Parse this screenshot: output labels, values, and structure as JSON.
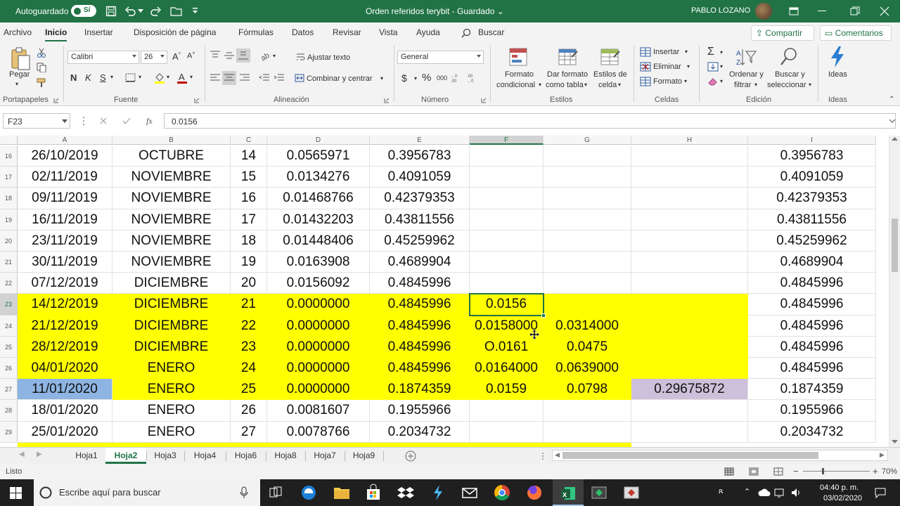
{
  "titlebar": {
    "autosave_label": "Autoguardado",
    "autosave_state": "Sí",
    "doc_title": "Orden referidos terybit  -  Guardado  ⌄",
    "user_name": "PABLO LOZANO"
  },
  "ribbon_tabs": [
    "Archivo",
    "Inicio",
    "Insertar",
    "Disposición de página",
    "Fórmulas",
    "Datos",
    "Revisar",
    "Vista",
    "Ayuda"
  ],
  "tell_me": "Buscar",
  "share_label": "Compartir",
  "comments_label": "Comentarios",
  "ribbon": {
    "clipboard": {
      "paste": "Pegar",
      "group": "Portapapeles"
    },
    "font": {
      "name": "Calibri",
      "size": "26",
      "bold": "N",
      "italic": "K",
      "underline": "S",
      "group": "Fuente"
    },
    "alignment": {
      "wrap": "Ajustar texto",
      "merge": "Combinar y centrar",
      "group": "Alineación"
    },
    "number": {
      "format": "General",
      "group": "Número"
    },
    "styles": {
      "conditional_1": "Formato",
      "conditional_2": "condicional",
      "table_1": "Dar formato",
      "table_2": "como tabla",
      "cell_1": "Estilos de",
      "cell_2": "celda",
      "group": "Estilos"
    },
    "cells": {
      "insert": "Insertar",
      "delete": "Eliminar",
      "format": "Formato",
      "group": "Celdas"
    },
    "editing": {
      "sort_1": "Ordenar y",
      "sort_2": "filtrar",
      "find_1": "Buscar y",
      "find_2": "seleccionar",
      "group": "Edición"
    },
    "ideas": {
      "label": "Ideas",
      "group": "Ideas"
    }
  },
  "formula_bar": {
    "name_box": "F23",
    "formula": "0.0156"
  },
  "columns": [
    "A",
    "B",
    "C",
    "D",
    "E",
    "F",
    "G",
    "H",
    "I"
  ],
  "rows": [
    {
      "num": "16",
      "cells": [
        "26/10/2019",
        "OCTUBRE",
        "14",
        "0.0565971",
        "0.3956783",
        "",
        "",
        "",
        "0.3956783"
      ]
    },
    {
      "num": "17",
      "cells": [
        "02/11/2019",
        "NOVIEMBRE",
        "15",
        "0.0134276",
        "0.4091059",
        "",
        "",
        "",
        "0.4091059"
      ]
    },
    {
      "num": "18",
      "cells": [
        "09/11/2019",
        "NOVIEMBRE",
        "16",
        "0.01468766",
        "0.42379353",
        "",
        "",
        "",
        "0.42379353"
      ]
    },
    {
      "num": "19",
      "cells": [
        "16/11/2019",
        "NOVIEMBRE",
        "17",
        "0.01432203",
        "0.43811556",
        "",
        "",
        "",
        "0.43811556"
      ]
    },
    {
      "num": "20",
      "cells": [
        "23/11/2019",
        "NOVIEMBRE",
        "18",
        "0.01448406",
        "0.45259962",
        "",
        "",
        "",
        "0.45259962"
      ]
    },
    {
      "num": "21",
      "cells": [
        "30/11/2019",
        "NOVIEMBRE",
        "19",
        "0.0163908",
        "0.4689904",
        "",
        "",
        "",
        "0.4689904"
      ]
    },
    {
      "num": "22",
      "cells": [
        "07/12/2019",
        "DICIEMBRE",
        "20",
        "0.0156092",
        "0.4845996",
        "",
        "",
        "",
        "0.4845996"
      ]
    },
    {
      "num": "23",
      "cells": [
        "14/12/2019",
        "DICIEMBRE",
        "21",
        "0.0000000",
        "0.4845996",
        "0.0156",
        "",
        "",
        "0.4845996"
      ]
    },
    {
      "num": "24",
      "cells": [
        "21/12/2019",
        "DICIEMBRE",
        "22",
        "0.0000000",
        "0.4845996",
        "0.0158000",
        "0.0314000",
        "",
        "0.4845996"
      ]
    },
    {
      "num": "25",
      "cells": [
        "28/12/2019",
        "DICIEMBRE",
        "23",
        "0.0000000",
        "0.4845996",
        "O.0161",
        "0.0475",
        "",
        "0.4845996"
      ]
    },
    {
      "num": "26",
      "cells": [
        "04/01/2020",
        "ENERO",
        "24",
        "0.0000000",
        "0.4845996",
        "0.0164000",
        "0.0639000",
        "",
        "0.4845996"
      ]
    },
    {
      "num": "27",
      "cells": [
        "11/01/2020",
        "ENERO",
        "25",
        "0.0000000",
        "0.1874359",
        "0.0159",
        "0.0798",
        "0.29675872",
        "0.1874359"
      ]
    },
    {
      "num": "28",
      "cells": [
        "18/01/2020",
        "ENERO",
        "26",
        "0.0081607",
        "0.1955966",
        "",
        "",
        "",
        "0.1955966"
      ]
    },
    {
      "num": "29",
      "cells": [
        "25/01/2020",
        "ENERO",
        "27",
        "0.0078766",
        "0.2034732",
        "",
        "",
        "",
        "0.2034732"
      ]
    }
  ],
  "colors": {
    "highlight_yellow": "#ffff00",
    "highlight_blue": "#8db4e2",
    "highlight_lilac": "#ccc0da",
    "excel_green": "#217346"
  },
  "sheets": [
    "Hoja1",
    "Hoja2",
    "Hoja3",
    "Hoja4",
    "Hoja6",
    "Hoja8",
    "Hoja7",
    "Hoja9"
  ],
  "active_sheet": "Hoja2",
  "status": {
    "ready": "Listo",
    "zoom": "70%"
  },
  "taskbar": {
    "search_placeholder": "Escribe aquí para buscar",
    "time": "04:40 p. m.",
    "date": "03/02/2020"
  }
}
